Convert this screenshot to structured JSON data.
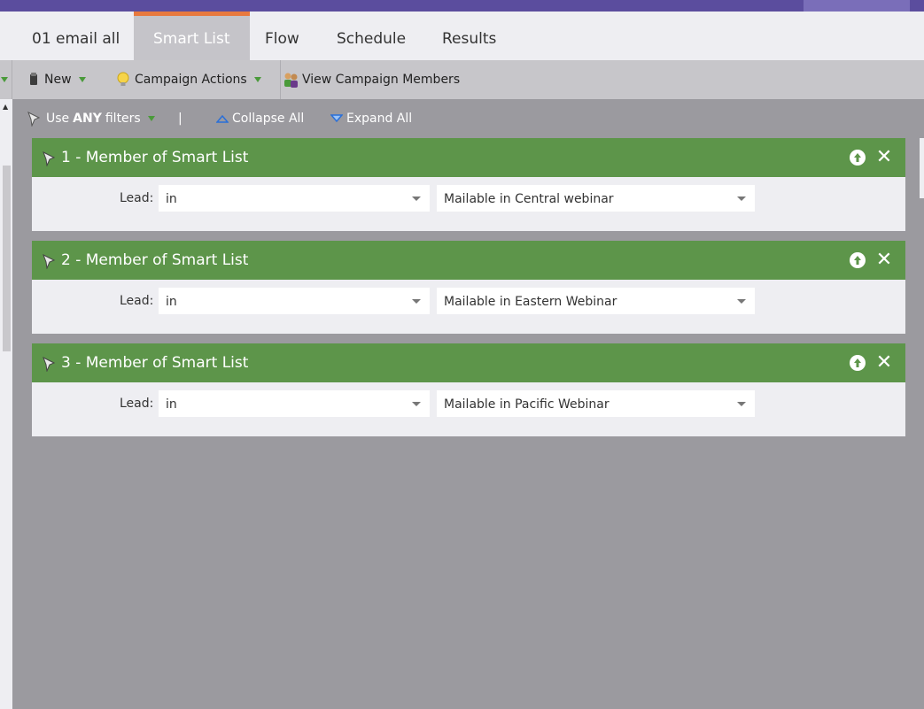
{
  "tabs": [
    {
      "label": "01 email all",
      "active": false
    },
    {
      "label": "Smart List",
      "active": true
    },
    {
      "label": "Flow",
      "active": false
    },
    {
      "label": "Schedule",
      "active": false
    },
    {
      "label": "Results",
      "active": false
    }
  ],
  "toolbar": {
    "new_label": "New",
    "campaign_actions_label": "Campaign Actions",
    "view_members_label": "View Campaign Members"
  },
  "filterbar": {
    "use_prefix": "Use",
    "use_bold": "ANY",
    "use_suffix": "filters",
    "separator": "|",
    "collapse_label": "Collapse All",
    "expand_label": "Expand All"
  },
  "filters": [
    {
      "title": "1 - Member of Smart List",
      "lead_label": "Lead:",
      "operator": "in",
      "value": "Mailable in Central webinar"
    },
    {
      "title": "2 - Member of Smart List",
      "lead_label": "Lead:",
      "operator": "in",
      "value": "Mailable in Eastern Webinar"
    },
    {
      "title": "3 - Member of Smart List",
      "lead_label": "Lead:",
      "operator": "in",
      "value": "Mailable in Pacific Webinar"
    }
  ],
  "colors": {
    "header_purple": "#5b4d9e",
    "active_tab_accent": "#e8793e",
    "filter_green": "#5d954a",
    "canvas_gray": "#9b9a9f"
  }
}
